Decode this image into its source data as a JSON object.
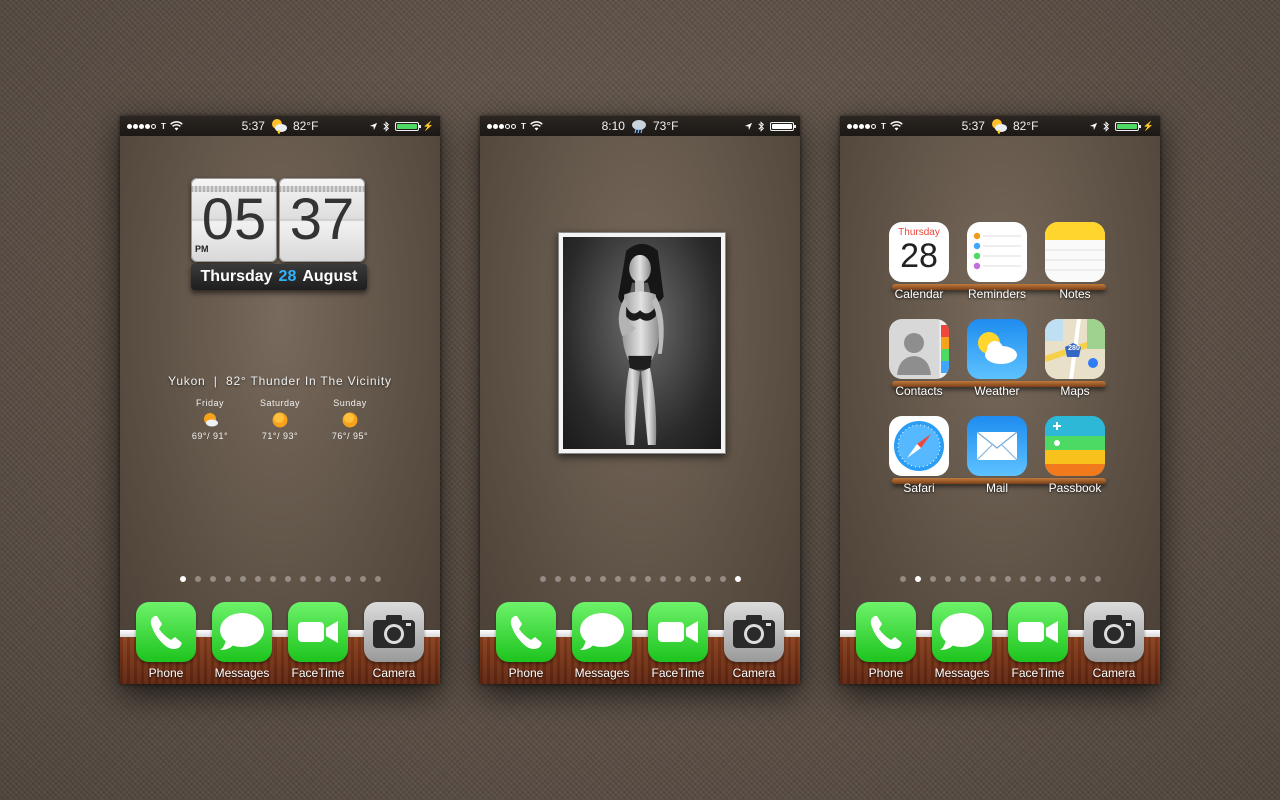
{
  "phones": [
    {
      "status": {
        "time": "5:37",
        "temp": "82°F",
        "signal_bars": 4,
        "battery_color": "#4cd964"
      },
      "clock": {
        "hour": "05",
        "minute": "37",
        "ampm": "PM",
        "weekday": "Thursday",
        "day": "28",
        "month": "August"
      },
      "weather": {
        "line": "Yukon  |  82° Thunder In The Vicinity",
        "forecast": [
          {
            "day": "Friday",
            "temps": "69°/ 91°",
            "icon": "partly-cloudy-icon"
          },
          {
            "day": "Saturday",
            "temps": "71°/ 93°",
            "icon": "sun-icon"
          },
          {
            "day": "Sunday",
            "temps": "76°/ 95°",
            "icon": "sun-icon"
          }
        ]
      },
      "pages": {
        "count": 14,
        "active": 0
      }
    },
    {
      "status": {
        "time": "8:10",
        "temp": "73°F",
        "signal_bars": 3,
        "battery_color": "#ffffff"
      },
      "photo": {
        "subject": "photo-widget"
      },
      "pages": {
        "count": 14,
        "active": 13
      }
    },
    {
      "status": {
        "time": "5:37",
        "temp": "82°F",
        "signal_bars": 4,
        "battery_color": "#4cd964"
      },
      "apps": [
        {
          "name": "Calendar",
          "icon": "calendar-icon",
          "weekday": "Thursday",
          "day": "28"
        },
        {
          "name": "Reminders",
          "icon": "reminders-icon"
        },
        {
          "name": "Notes",
          "icon": "notes-icon"
        },
        {
          "name": "Contacts",
          "icon": "contacts-icon"
        },
        {
          "name": "Weather",
          "icon": "weather-icon"
        },
        {
          "name": "Maps",
          "icon": "maps-icon",
          "badge": "280"
        },
        {
          "name": "Safari",
          "icon": "safari-icon"
        },
        {
          "name": "Mail",
          "icon": "mail-icon"
        },
        {
          "name": "Passbook",
          "icon": "passbook-icon"
        }
      ],
      "pages": {
        "count": 14,
        "active": 1
      }
    }
  ],
  "dock": [
    {
      "name": "Phone",
      "icon": "phone-icon"
    },
    {
      "name": "Messages",
      "icon": "messages-icon"
    },
    {
      "name": "FaceTime",
      "icon": "facetime-icon"
    },
    {
      "name": "Camera",
      "icon": "camera-icon"
    }
  ]
}
